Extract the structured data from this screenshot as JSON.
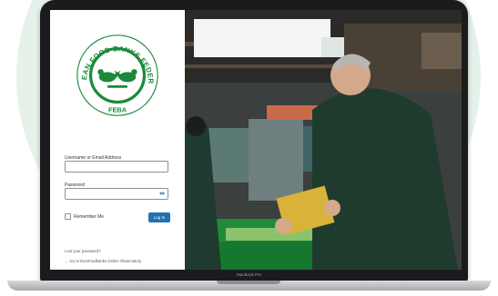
{
  "logo": {
    "ring_text": "EUROPEAN FOOD BANKS FEDERATION",
    "acronym": "FEBA",
    "brand_color": "#1a8a3a"
  },
  "login": {
    "username_label": "Username or Email Address",
    "username_value": "",
    "password_label": "Password",
    "password_value": "",
    "remember_label": "Remember Me",
    "login_button": "Log In",
    "lost_password": "Lost your password?",
    "back_link": "← Go to Eurofoodbanks Online Observatory"
  },
  "device": {
    "label": "MacBook Pro"
  },
  "colors": {
    "button": "#2271b1",
    "background_circle": "#e6f1ea"
  }
}
